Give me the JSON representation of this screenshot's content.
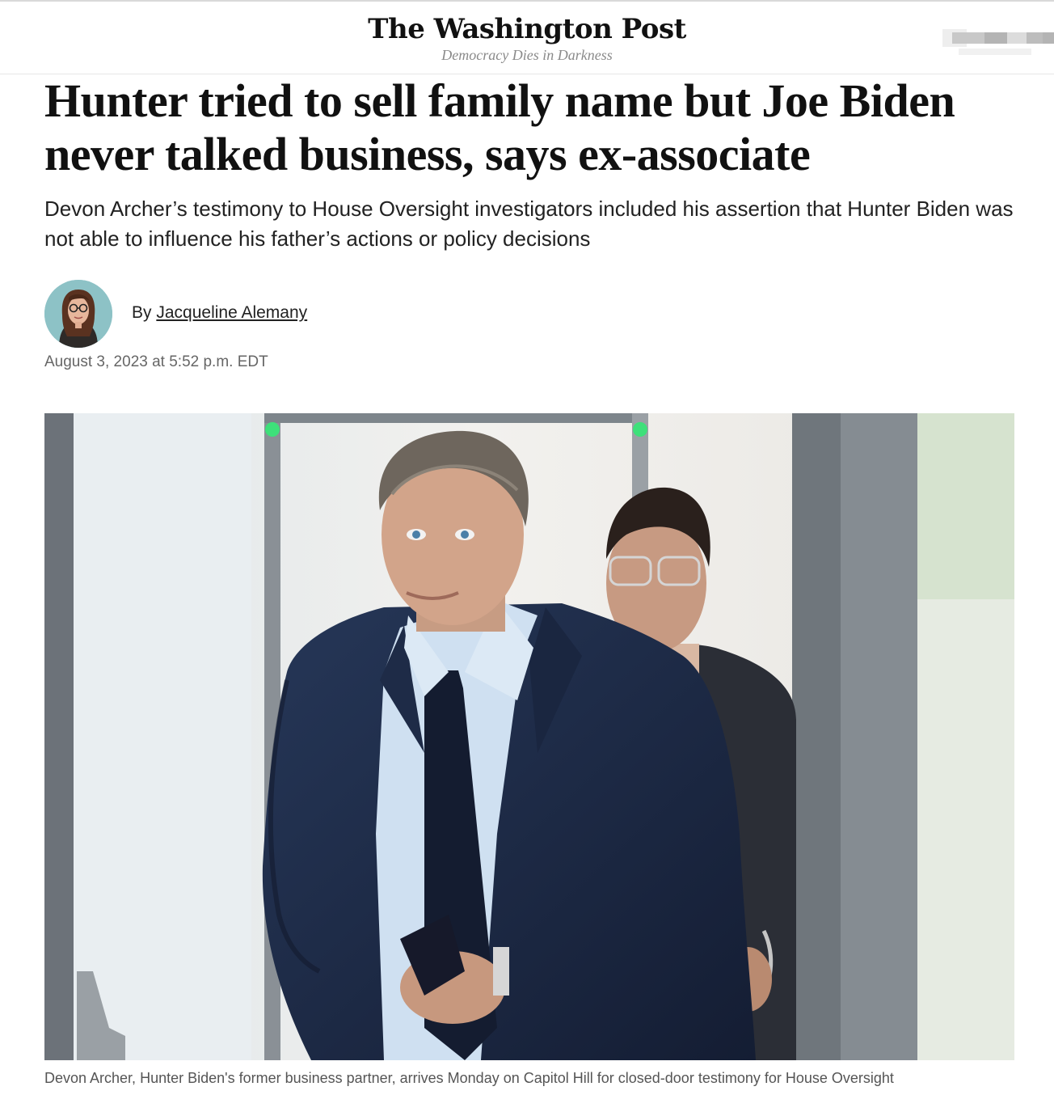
{
  "masthead": {
    "logo": "The Washington Post",
    "tagline": "Democracy Dies in Darkness"
  },
  "article": {
    "headline_line1": "Hunter tried to sell family name but Joe Biden",
    "headline_line2": "never talked business, says ex-associate",
    "subhead": "Devon Archer’s testimony to House Oversight investigators included his assertion that Hunter Biden was not able to influence his father’s actions or policy decisions",
    "byline_prefix": "By",
    "author": "Jacqueline Alemany",
    "timestamp": "August 3, 2023 at 5:52 p.m. EDT",
    "caption": "Devon Archer, Hunter Biden's former business partner, arrives Monday on Capitol Hill for closed-door testimony for House Oversight"
  },
  "colors": {
    "text": "#111111",
    "muted": "#666666",
    "suit": "#1c2a45",
    "shirt": "#c9dcee"
  }
}
